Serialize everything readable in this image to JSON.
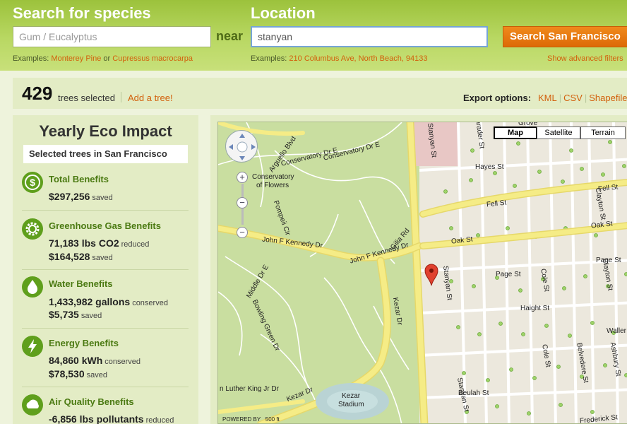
{
  "search": {
    "species_title": "Search for species",
    "species_placeholder": "Gum / Eucalyptus",
    "near_label": "near",
    "location_title": "Location",
    "location_value": "stanyan",
    "search_button": "Search San Francisco",
    "species_examples_prefix": "Examples:",
    "species_example_1": "Monterey Pine",
    "species_examples_or": "or",
    "species_example_2": "Cupressus macrocarpa",
    "location_examples_prefix": "Examples:",
    "location_example": "210 Columbus Ave, North Beach, 94133",
    "advanced_filters": "Show advanced filters"
  },
  "summary": {
    "count": "429",
    "count_label": "trees selected",
    "add_tree": "Add a tree!",
    "export_label": "Export options:",
    "export_kml": "KML",
    "export_csv": "CSV",
    "export_shapefile": "Shapefile"
  },
  "eco": {
    "title": "Yearly Eco Impact",
    "subtitle": "Selected trees in San Francisco",
    "benefits": [
      {
        "name": "Total Benefits",
        "icon": "dollar-icon",
        "lines": [
          {
            "value": "$297,256",
            "unit": "saved"
          }
        ]
      },
      {
        "name": "Greenhouse Gas Benefits",
        "icon": "gear-icon",
        "lines": [
          {
            "value": "71,183 lbs CO2",
            "unit": "reduced"
          },
          {
            "value": "$164,528",
            "unit": "saved"
          }
        ]
      },
      {
        "name": "Water Benefits",
        "icon": "water-drop-icon",
        "lines": [
          {
            "value": "1,433,982 gallons",
            "unit": "conserved"
          },
          {
            "value": "$5,735",
            "unit": "saved"
          }
        ]
      },
      {
        "name": "Energy Benefits",
        "icon": "lightning-icon",
        "lines": [
          {
            "value": "84,860 kWh",
            "unit": "conserved"
          },
          {
            "value": "$78,530",
            "unit": "saved"
          }
        ]
      },
      {
        "name": "Air Quality Benefits",
        "icon": "cloud-icon",
        "lines": [
          {
            "value": "-6,856 lbs pollutants",
            "unit": "reduced"
          }
        ]
      }
    ]
  },
  "map": {
    "type_map": "Map",
    "type_satellite": "Satellite",
    "type_terrain": "Terrain",
    "labels": {
      "conservatory_dr_e": "Conservatory Dr E",
      "conservatory_dr_w": "Conservatory Dr E",
      "conservatory": "Conservatory",
      "of_flowers": "of Flowers",
      "arguello": "Arguello Blvd",
      "jfk_left": "John F Kennedy Dr",
      "jfk_right": "John F Kennedy Dr",
      "middle_dr": "Middle Dr E",
      "kezar_dr": "Kezar Dr",
      "kezar_dr_2": "Kezar Dr",
      "kezar_stadium_1": "Kezar",
      "kezar_stadium_2": "Stadium",
      "bowling_green": "Bowling Green Dr",
      "mlk": "n Luther King Jr Dr",
      "stanyan_1": "Stanyan St",
      "stanyan_2": "Stanyan St",
      "stanyan_3": "Stanyan St",
      "shrader": "Shrader St",
      "hayes": "Hayes St",
      "fell_left": "Fell St",
      "fell_right": "Fell St",
      "oak_left": "Oak St",
      "oak_right": "Oak St",
      "page_left": "Page St",
      "page_right": "Page St",
      "haight": "Haight St",
      "cole_top": "Cole St",
      "cole_bottom": "Cole St",
      "clayton_top": "Clayton St",
      "clayton_bottom": "Clayton St",
      "belvedere": "Belvedere St",
      "ashbury": "Ashbury St",
      "waller": "Waller",
      "beulah": "Beulah St",
      "frederick": "Frederick St",
      "grove": "Grove",
      "pompeii": "Pompeii Cir",
      "gilia": "Gilia Rd",
      "scale": "500 ft",
      "powered": "POWERED BY"
    }
  }
}
